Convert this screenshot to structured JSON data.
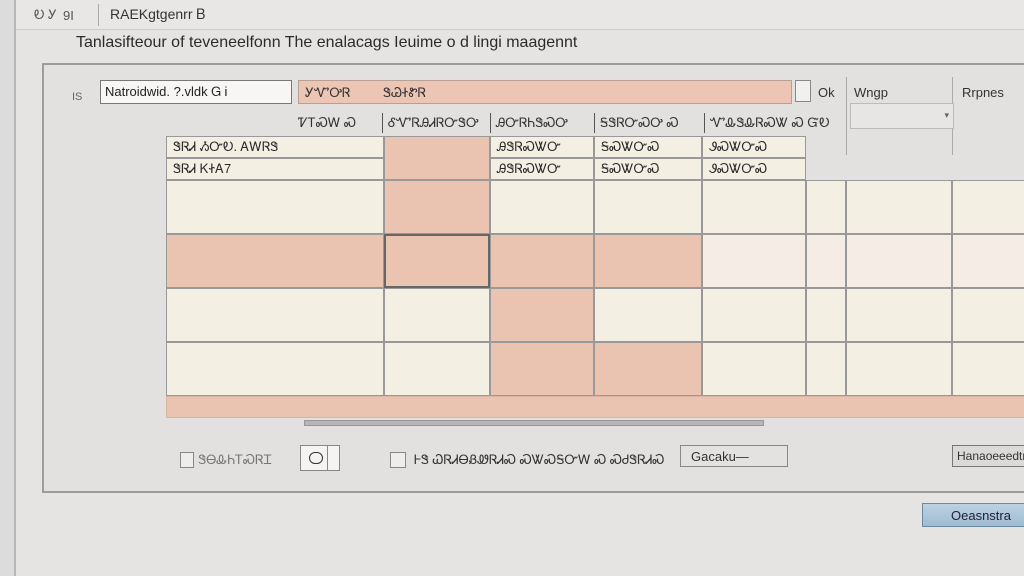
{
  "window": {
    "left_label": "Ꭷ Ꭹ",
    "left_number": "9I",
    "title": "RAEKgtgenrr Ᏼ"
  },
  "heading": "Tanlasifteour of teveneelfonn The enalacags Ieuime o d lingi maagennt",
  "toolbar": {
    "checkbox_label": "IS",
    "search_value": "Natroidwid. ?.vldk Ꮐ Ꭵ ",
    "filter_label": "ᎩᏉᎤᏒ",
    "filter_value": "ᏕᏊᏐᏑᏒ",
    "ok_label": "Ok",
    "right_col_1_label": "Wngp",
    "right_col_2_label": "Rrpnes"
  },
  "column_headers": [
    {
      "text": "ᏤᎢᏍᎳ  Ꮝ"
    },
    {
      "text": "ᎴᏉᏒᎯᏗᏒᏅᏕᎤ"
    },
    {
      "text": "ᎯᏅᏒᏂᏕᏍᎤ"
    },
    {
      "text": "ᎦᏕᏒᏅᏍᎤ  Ꮝ"
    },
    {
      "text": "ᏉᎲᏕᎲᏒᏍᏔ  Ꮝ  ᏳᎧ"
    }
  ],
  "table": {
    "row_labels": [
      "ᏕᏒᏗ ᏱᏅᎧ. ᎪᎳᏒᏕ",
      "ᏕᏒᏗ ᏦᏐᎪ7"
    ],
    "col2_cells": [
      "ᎯᏕᏒᏍᏔᏅ",
      "ᎯᏕᏒᏍᏔᏅ"
    ],
    "col3_cells": [
      "ᎦᏍᏔᏅᏍ",
      "ᎦᏍᏔᏅᏍ"
    ],
    "col4_cells": [
      "ᏭᏍᏔᏅᏍ",
      "ᏭᏍᏔᏅᏍ"
    ]
  },
  "bottom": {
    "check_a_label": "ᏕᎾᎲᏂᎢᏍᏒᏆ",
    "check_b_label": "ᎰᏕ ᏇᏒᏗᎾᏰᏪᏒᏗᏍ ᏍᏔᏍᎦᏅᎳ Ꮝ  ᏍᏧᏕᏒᏗᏍ",
    "combo_value": "Gacaku—",
    "combo_right_value": "Hanaoeeedtran"
  },
  "primary_button_label": "Oeasnstra"
}
